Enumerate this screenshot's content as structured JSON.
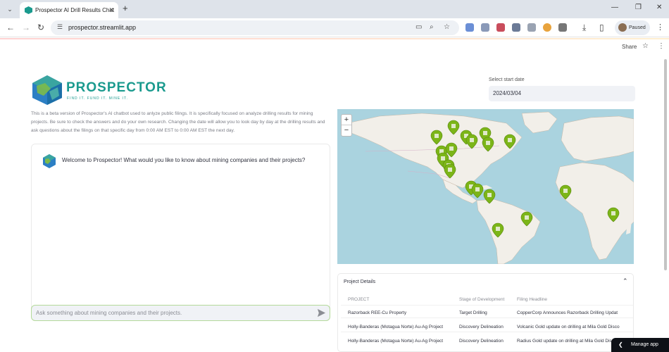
{
  "browser": {
    "tab_title": "Prospector AI Drill Results Chat",
    "url": "prospector.streamlit.app",
    "profile_status": "Paused"
  },
  "header": {
    "share_label": "Share"
  },
  "brand": {
    "name": "PROSPECTOR",
    "tagline": "FIND IT. FUND IT. MINE IT."
  },
  "intro_text": "This is a beta version of Prospector's AI chatbot used to anlyze public filings. It is specifically focused on analyze drilling results for mining projects. Be sure to check the answers and do your own research. Changing the date will allow you to look day by day at the drilling results and ask questions about the filings on that specific day from 0:00 AM EST to 0:00 AM EST the next day.",
  "date_picker": {
    "label": "Select start date",
    "value": "2024/03/04"
  },
  "chat": {
    "welcome": "Welcome to Prospector! What would you like to know about mining companies and their projects?",
    "placeholder": "Ask something about mining companies and their projects."
  },
  "map": {
    "zoom_in": "+",
    "zoom_out": "−",
    "marker_color": "#7cb518"
  },
  "project_details": {
    "title": "Project Details",
    "columns": [
      "PROJECT",
      "Stage of Development",
      "Filing Headline"
    ],
    "rows": [
      [
        "Razorback REE-Cu Property",
        "Target Drilling",
        "CopperCorp Announces Razorback Drilling Updat"
      ],
      [
        "Holly-Banderas (Motagua Norte) Au-Ag Project",
        "Discovery Delineation",
        "Volcanic Gold update on drilling at Mila Gold Disco"
      ],
      [
        "Holly-Banderas (Motagua Norte) Au-Ag Project",
        "Discovery Delineation",
        "Radius Gold update on drilling at Mila Gold Discov"
      ]
    ]
  },
  "manage_app_label": "Manage app",
  "colors": {
    "brand_teal": "#1a9a8e",
    "input_border": "#b4d99a"
  }
}
